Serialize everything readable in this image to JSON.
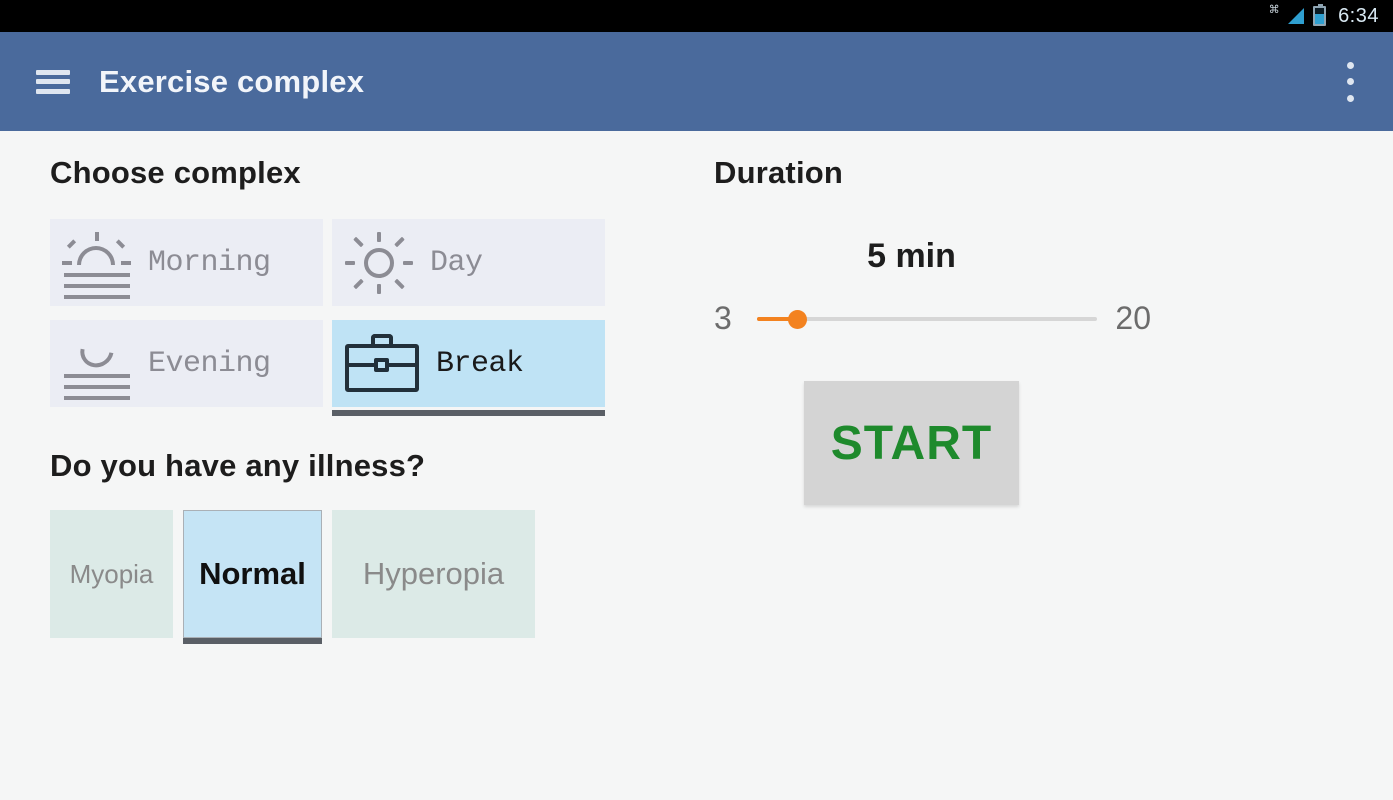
{
  "statusbar": {
    "time": "6:34",
    "icons": [
      "x-badge-icon",
      "signal-icon",
      "battery-icon"
    ]
  },
  "toolbar": {
    "menu_icon": "hamburger-menu-icon",
    "title": "Exercise complex",
    "overflow_icon": "more-vertical-icon"
  },
  "complex": {
    "title": "Choose complex",
    "options": [
      {
        "label": "Morning",
        "icon": "sunrise-icon",
        "selected": false
      },
      {
        "label": "Day",
        "icon": "sun-icon",
        "selected": false
      },
      {
        "label": "Evening",
        "icon": "moonset-icon",
        "selected": false
      },
      {
        "label": "Break",
        "icon": "briefcase-icon",
        "selected": true
      }
    ]
  },
  "illness": {
    "title": "Do you have any illness?",
    "options": [
      {
        "label": "Myopia",
        "selected": false
      },
      {
        "label": "Normal",
        "selected": true
      },
      {
        "label": "Hyperopia",
        "selected": false
      }
    ]
  },
  "duration": {
    "title": "Duration",
    "value_label": "5 min",
    "value": 5,
    "min_label": "3",
    "max_label": "20",
    "min": 3,
    "max": 20
  },
  "start": {
    "label": "START"
  },
  "colors": {
    "toolbar": "#4a6a9c",
    "page_background": "#f5f6f6",
    "complex_option": "#ebedf4",
    "complex_selected": "#bfe3f5",
    "illness_option": "#dceae7",
    "illness_selected": "#c5e4f5",
    "slider_accent": "#f3821f",
    "slider_rail": "#d6d6d6",
    "start_background": "#d4d4d4",
    "start_text": "#1e8a2c",
    "selection_underline": "#5a5f66"
  }
}
